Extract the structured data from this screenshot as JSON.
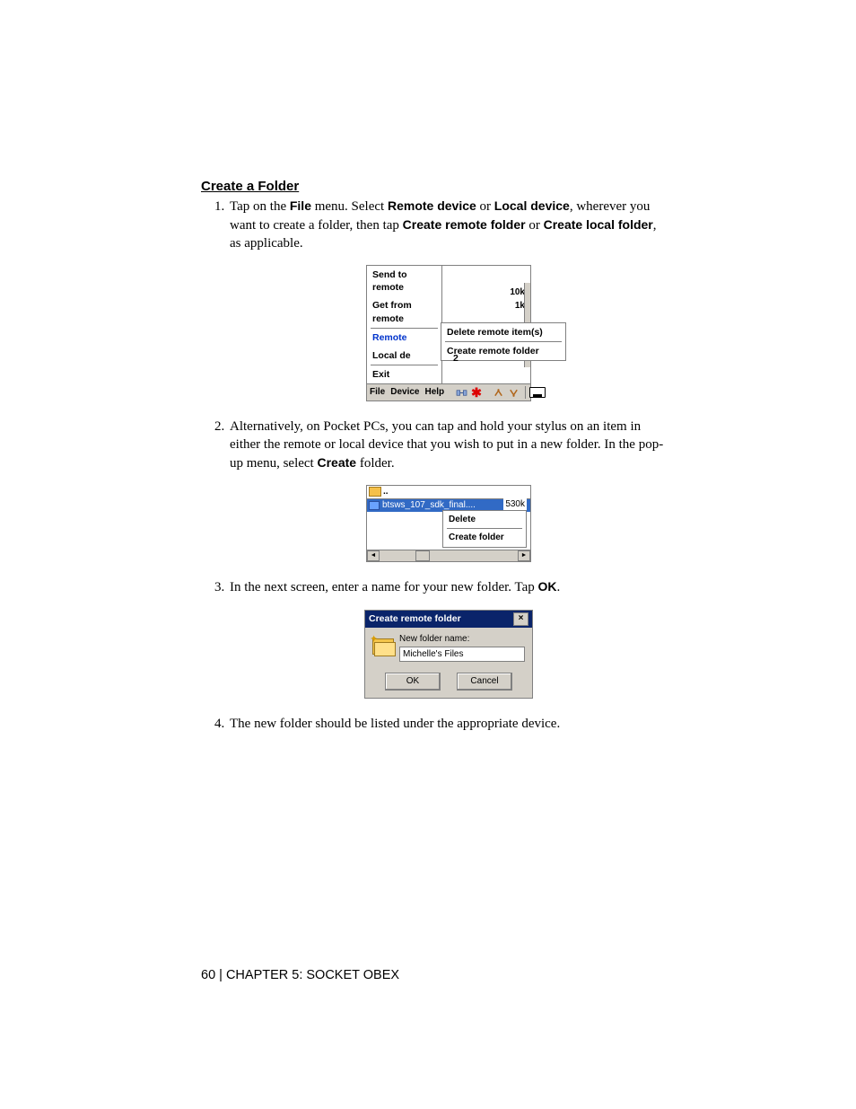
{
  "heading": "Create a Folder",
  "step1": {
    "pre": "Tap on the ",
    "b1": "File",
    "mid1": " menu. Select ",
    "b2": "Remote device",
    "mid2": " or ",
    "b3": "Local device",
    "mid3": ", wherever you want to create a folder, then tap ",
    "b4": "Create remote folder",
    "mid4": " or ",
    "b5": "Create local folder",
    "post": ", as applicable."
  },
  "fig1": {
    "send": "Send to remote",
    "get": "Get from remote",
    "remote": "Remote",
    "localde": "Local de",
    "exit": "Exit",
    "size1": "10k",
    "size2": "1k",
    "deleteRemote": "Delete remote item(s)",
    "createRemote": "Create remote folder",
    "file": "File",
    "device": "Device",
    "help": "Help",
    "two": "2"
  },
  "step2": {
    "pre": "Alternatively, on Pocket PCs, you can tap and hold your stylus on an item in either the remote or local device that you wish to put in a new folder. In the pop-up menu, select ",
    "b1": "Create",
    "post": " folder."
  },
  "fig2": {
    "dots": "..",
    "filename": "btsws_107_sdk_final....",
    "filesize": "530k",
    "delete": "Delete",
    "create": "Create folder",
    "left": "◄",
    "right": "►"
  },
  "step3": {
    "pre": "In the next screen, enter a name for your new folder. Tap ",
    "b1": "OK",
    "post": "."
  },
  "fig3": {
    "title": "Create remote folder",
    "close": "×",
    "label": "New folder name:",
    "value": "Michelle's Files",
    "ok": "OK",
    "cancel": "Cancel"
  },
  "step4": "The new folder should be listed under the appropriate device.",
  "footer": "60  | CHAPTER 5: SOCKET OBEX"
}
